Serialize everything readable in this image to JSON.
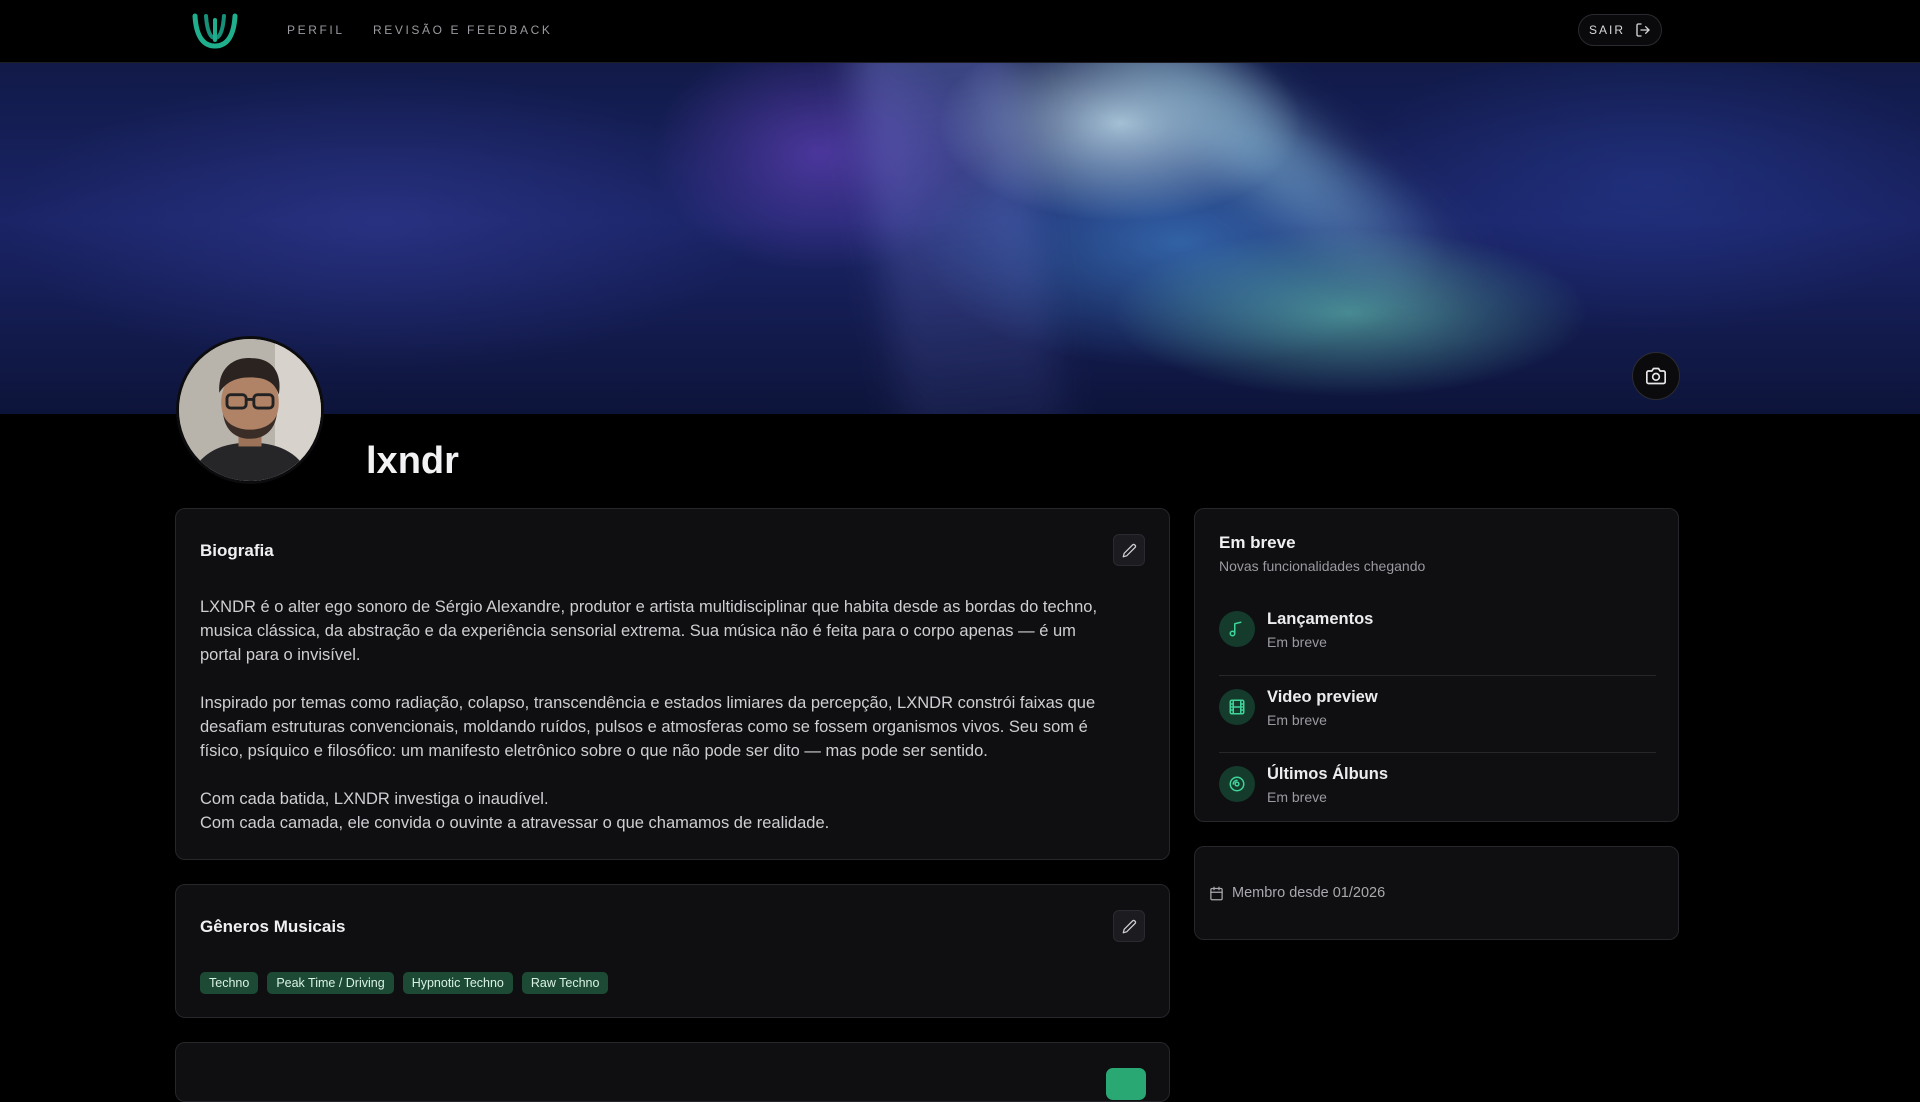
{
  "nav": {
    "links": [
      "PERFIL",
      "REVISÃO E FEEDBACK"
    ],
    "logout_label": "SAIR"
  },
  "profile": {
    "name": "lxndr"
  },
  "biography": {
    "title": "Biografia",
    "paragraphs": [
      [
        "LXNDR é o alter ego sonoro de Sérgio Alexandre, produtor e artista multidisciplinar que habita desde as bordas do techno,",
        "musica clássica, da abstração e da experiência sensorial extrema. Sua música não é feita para o corpo apenas — é um",
        "portal para o invisível."
      ],
      [
        "Inspirado por temas como radiação, colapso, transcendência e estados limiares da percepção, LXNDR constrói faixas que",
        "desafiam estruturas convencionais, moldando ruídos, pulsos e atmosferas como se fossem organismos vivos. Seu som é",
        "físico, psíquico e filosófico: um manifesto eletrônico sobre o que não pode ser dito — mas pode ser sentido."
      ],
      [
        "Com cada batida, LXNDR investiga o inaudível.",
        "Com cada camada, ele convida o ouvinte a atravessar o que chamamos de realidade."
      ]
    ]
  },
  "genres": {
    "title": "Gêneros Musicais",
    "tags": [
      "Techno",
      "Peak Time / Driving",
      "Hypnotic Techno",
      "Raw Techno"
    ]
  },
  "coming_soon": {
    "title": "Em breve",
    "subtitle": "Novas funcionalidades chegando",
    "items": [
      {
        "name": "Lançamentos",
        "status": "Em breve",
        "icon": "music-note-icon"
      },
      {
        "name": "Video preview",
        "status": "Em breve",
        "icon": "film-icon"
      },
      {
        "name": "Últimos Álbuns",
        "status": "Em breve",
        "icon": "disc-icon"
      }
    ]
  },
  "member": {
    "text": "Membro desde 01/2026"
  },
  "colors": {
    "accent": "#2aa874",
    "tag_bg": "#1d4a35",
    "background": "#000000",
    "card_bg": "#0f0f11"
  }
}
